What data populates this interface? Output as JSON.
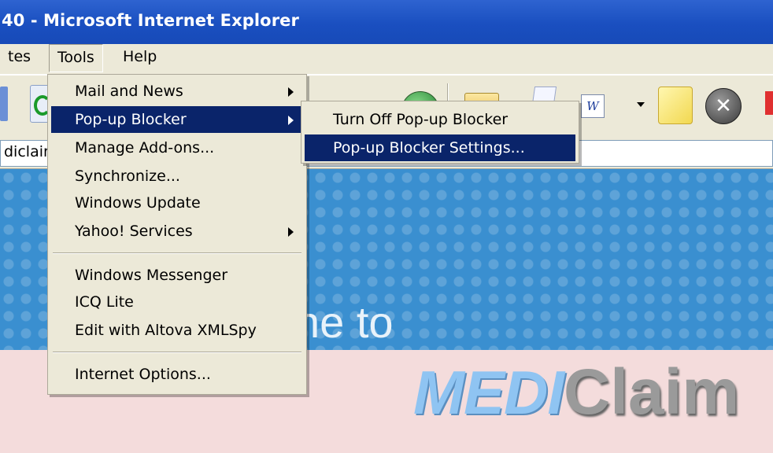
{
  "window": {
    "title": "40 - Microsoft Internet Explorer"
  },
  "menubar": {
    "items": [
      "tes",
      "Tools",
      "Help"
    ]
  },
  "address": {
    "value": "diclair"
  },
  "tools_menu": {
    "items": [
      {
        "label": "Mail and News",
        "submenu": true
      },
      {
        "label": "Pop-up Blocker",
        "submenu": true,
        "highlighted": true
      },
      {
        "label": "Manage Add-ons..."
      },
      {
        "label": "Synchronize..."
      },
      {
        "label": "Windows Update"
      },
      {
        "label": "Yahoo! Services",
        "submenu": true
      },
      {
        "label": "Windows Messenger"
      },
      {
        "label": "ICQ Lite"
      },
      {
        "label": "Edit with Altova XMLSpy"
      },
      {
        "label": "Internet Options..."
      }
    ]
  },
  "popup_submenu": {
    "items": [
      {
        "label": "Turn Off Pop-up Blocker"
      },
      {
        "label": "Pop-up Blocker Settings...",
        "highlighted": true
      }
    ]
  },
  "page": {
    "welcome_text": "ne to",
    "logo_medi": "MEDI",
    "logo_claim": "Claim"
  },
  "colors": {
    "titlebar": "#1a4fc0",
    "menu_bg": "#ece9d8",
    "highlight": "#0a246a",
    "page_blue": "#3a8fd0",
    "page_pink": "#f4dcdc"
  },
  "icons": [
    "refresh-icon",
    "green-arrow-icon",
    "globe-icon",
    "folder-icon",
    "document-icon",
    "word-icon",
    "dropdown-arrow-icon",
    "sticky-note-icon",
    "close-circle-icon"
  ]
}
